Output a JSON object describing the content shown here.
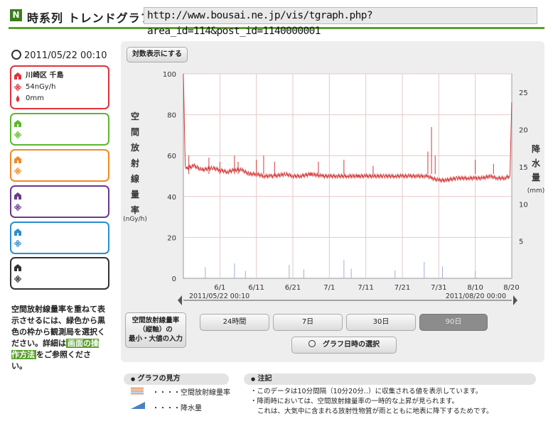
{
  "header": {
    "title": "時系列 トレンドグラフ",
    "logo_letter": "N",
    "url": "http://www.bousai.ne.jp/vis/tgraph.php?area_id=114&post_id=1140000001"
  },
  "datetime": "2011/05/22 00:10",
  "cards": [
    {
      "name": "川崎区 千島",
      "rate": "54nGy/h",
      "rain": "0mm",
      "color": "#e0323c"
    },
    {
      "name": "",
      "rate": "",
      "rain": "",
      "color": "#5cb82e"
    },
    {
      "name": "",
      "rate": "",
      "rain": "",
      "color": "#f08a25"
    },
    {
      "name": "",
      "rate": "",
      "rain": "",
      "color": "#6a3a8c"
    },
    {
      "name": "",
      "rate": "",
      "rain": "",
      "color": "#2a8ed0"
    },
    {
      "name": "",
      "rate": "",
      "rain": "",
      "color": "#333333"
    }
  ],
  "note": {
    "text_before": "空間放射線量率を重ねて表示させるには、緑色から黒色の枠から観測局を選択ください。詳細は",
    "link": "画面の操作方法",
    "text_after": "をご参照ください。"
  },
  "controls": {
    "log_button": "対数表示にする",
    "range_button": "空間放射線量率（縦軸）の最小・大値の入力",
    "range_lines": [
      "空間放射線量率",
      "（縦軸）の",
      "最小・大値の入力"
    ],
    "periods": [
      "24時間",
      "7日",
      "30日",
      "90日"
    ],
    "active_period": "90日",
    "select_button": "グラフ日時の選択"
  },
  "chart_data": {
    "type": "line",
    "ylabel_chars": [
      "空",
      "間",
      "放",
      "射",
      "線",
      "量",
      "率"
    ],
    "yunit": "(nGy/h)",
    "y2label_chars": [
      "降",
      "水",
      "量"
    ],
    "y2unit": "(mm)",
    "ylim": [
      0,
      100
    ],
    "yticks": [
      0,
      20,
      40,
      60,
      80,
      100
    ],
    "y2lim": [
      0,
      27.5
    ],
    "y2ticks": [
      5,
      10,
      15,
      20,
      25
    ],
    "xticks": [
      "6/1",
      "6/11",
      "6/21",
      "7/1",
      "7/11",
      "7/21",
      "7/31",
      "8/10",
      "8/20"
    ],
    "range_start": "2011/05/22 00:10",
    "range_end": "2011/08/20 00:00",
    "series": [
      {
        "name": "空間放射線量率",
        "color": "#d23a3a",
        "x_days": [
          0,
          0.5,
          1,
          3,
          5,
          8,
          10,
          12,
          14,
          16,
          18,
          20,
          22,
          24,
          25,
          28,
          30,
          32,
          35,
          38,
          40,
          42,
          45,
          48,
          50,
          52,
          55,
          58,
          60,
          62,
          64,
          66,
          67,
          68,
          70,
          72,
          75,
          78,
          80,
          82,
          84,
          86,
          88,
          89.5,
          90
        ],
        "values": [
          100,
          55,
          54,
          55,
          53,
          54,
          53,
          52,
          53,
          53,
          51,
          51,
          50,
          50,
          50,
          51,
          50,
          50,
          51,
          50,
          50,
          50,
          50,
          50,
          50,
          50,
          50,
          50,
          50,
          50,
          50,
          50,
          50,
          49,
          48,
          48,
          49,
          49,
          49,
          49,
          50,
          49,
          49,
          50,
          86
        ]
      },
      {
        "name": "降水量",
        "color": "#9bb0dd",
        "note": "sparse small bars near zero"
      }
    ]
  },
  "legend": {
    "title": "グラフの見方",
    "items": [
      "空間放射線量率",
      "降水量"
    ],
    "item_prefix": "・・・・"
  },
  "notes_panel": {
    "title": "注記",
    "lines": [
      "・このデータは10分間隔（10分20分‥）に収集される値を表示しています。",
      "・降雨時においては、空間放射線量率の一時的な上昇が見られます。",
      "これは、大気中に含まれる放射性物質が雨とともに地表に降下するためです。"
    ]
  }
}
